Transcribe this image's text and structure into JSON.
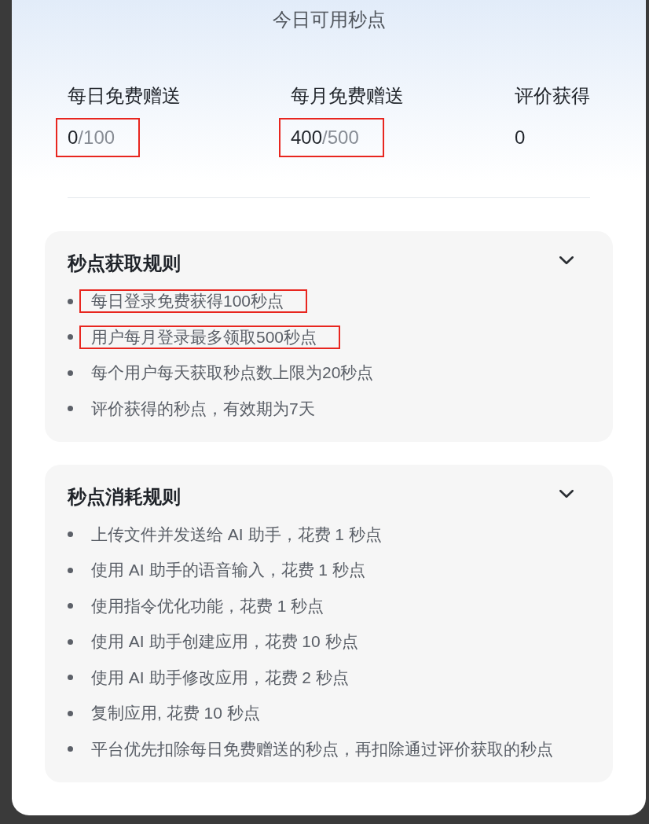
{
  "dialog": {
    "title": "今日可用秒点"
  },
  "stats": [
    {
      "label": "每日免费赠送",
      "value": "0",
      "total": "/100",
      "highlighted": true
    },
    {
      "label": "每月免费赠送",
      "value": "400",
      "total": "/500",
      "highlighted": true
    },
    {
      "label": "评价获得",
      "value": "0",
      "highlighted": false
    }
  ],
  "sections": [
    {
      "title": "秒点获取规则",
      "expanded": true,
      "items": [
        {
          "text": "每日登录免费获得100秒点",
          "highlighted": true
        },
        {
          "text": "用户每月登录最多领取500秒点",
          "highlighted": true
        },
        {
          "text": "每个用户每天获取秒点数上限为20秒点",
          "highlighted": false
        },
        {
          "text": "评价获得的秒点，有效期为7天",
          "highlighted": false
        }
      ]
    },
    {
      "title": "秒点消耗规则",
      "expanded": true,
      "items": [
        {
          "text": "上传文件并发送给 AI 助手，花费 1 秒点",
          "highlighted": false
        },
        {
          "text": "使用 AI 助手的语音输入，花费 1 秒点",
          "highlighted": false
        },
        {
          "text": "使用指令优化功能，花费 1 秒点",
          "highlighted": false
        },
        {
          "text": "使用 AI 助手创建应用，花费 10 秒点",
          "highlighted": false
        },
        {
          "text": "使用 AI 助手修改应用，花费 2 秒点",
          "highlighted": false
        },
        {
          "text": "复制应用, 花费 10 秒点",
          "highlighted": false
        },
        {
          "text": "平台优先扣除每日免费赠送的秒点，再扣除通过评价获取的秒点",
          "highlighted": false
        }
      ]
    }
  ]
}
